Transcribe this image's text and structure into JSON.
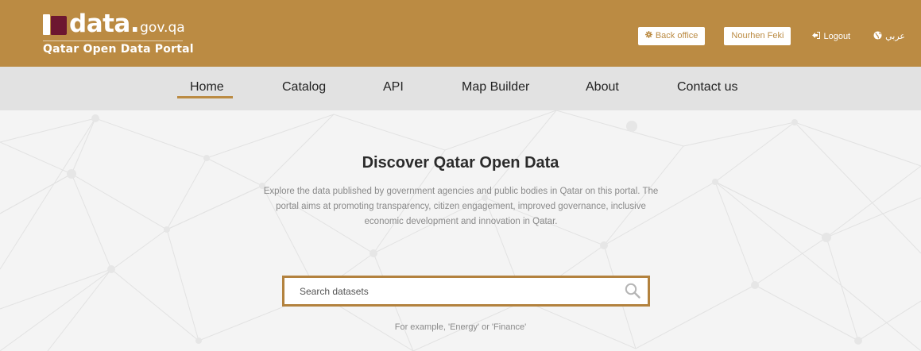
{
  "header": {
    "logo_main": "data.",
    "logo_suffix": "gov.qa",
    "logo_subtitle": "Qatar Open Data Portal",
    "back_office_label": "Back office",
    "user_name": "Nourhen Feki",
    "logout_label": "Logout",
    "language_label": "عربي",
    "background_color": "#bb8b43"
  },
  "nav": {
    "items": [
      {
        "label": "Home",
        "active": true
      },
      {
        "label": "Catalog"
      },
      {
        "label": "API"
      },
      {
        "label": "Map Builder"
      },
      {
        "label": "About"
      },
      {
        "label": "Contact us"
      }
    ]
  },
  "hero": {
    "title": "Discover Qatar Open Data",
    "description": "Explore the data published by government agencies and public bodies in Qatar on this portal. The portal aims at promoting transparency, citizen engagement, improved governance, inclusive economic development and innovation in Qatar.",
    "search_placeholder": "Search datasets",
    "example_text": "For example, 'Energy' or 'Finance'",
    "accent_color": "#b3823e"
  },
  "icons": {
    "back_office": "gear-icon",
    "logout": "logout-icon",
    "language": "globe-icon",
    "search": "search-icon"
  }
}
